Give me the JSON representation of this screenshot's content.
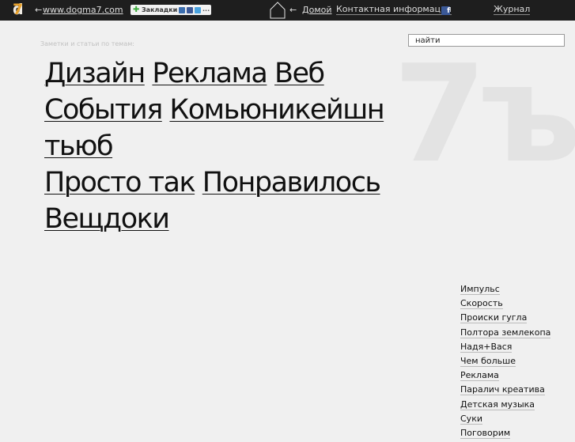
{
  "topbar": {
    "logo_d": "d",
    "logo_7": "7",
    "back_arrow": "←",
    "site_link": "www.dogma7.com",
    "bookmarks_label": "Закладки",
    "bookmarks_more": "...",
    "home_arrow": "←",
    "home_label": "Домой",
    "contact_label": "Контактная информация",
    "facebook_glyph": "f",
    "journal_label": "Журнал",
    "icons": [
      "home-icon",
      "facebook-icon",
      "plus-icon"
    ]
  },
  "search": {
    "placeholder": "найти"
  },
  "subtitle": "Заметки и статьи по темам:",
  "watermark": "7ъ",
  "tags": [
    "Дизайн",
    "Реклама",
    "Веб",
    "События",
    "Комьюникейшн",
    "тьюб",
    "Просто так",
    "Понравилось",
    "Вещдоки"
  ],
  "posts": [
    "Импульс",
    "Скорость",
    "Происки гугла",
    "Полтора землекопа",
    "Надя+Вася",
    "Чем больше",
    "Реклама",
    "Паралич креатива",
    "Детская музыка",
    "Суки",
    "Поговорим"
  ],
  "colors": {
    "topbar": "#1e1e1e",
    "background": "#f0f0f0",
    "logo_accent": "#e9a22c",
    "facebook": "#3b5998"
  }
}
